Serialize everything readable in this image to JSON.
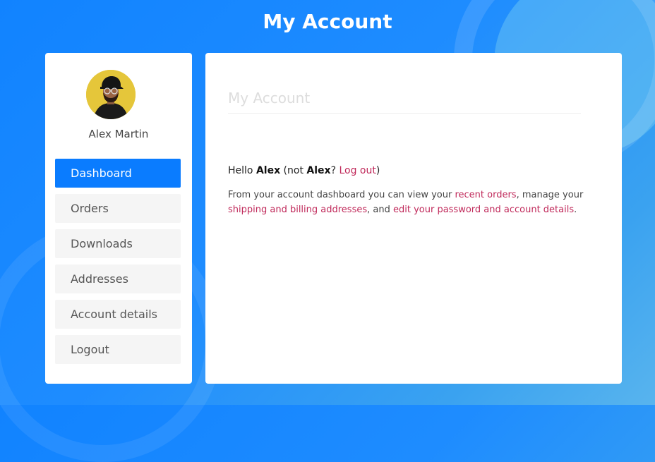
{
  "page": {
    "title": "My Account"
  },
  "user": {
    "name": "Alex Martin",
    "first_name": "Alex"
  },
  "sidebar": {
    "items": [
      {
        "label": "Dashboard",
        "active": true
      },
      {
        "label": "Orders"
      },
      {
        "label": "Downloads"
      },
      {
        "label": "Addresses"
      },
      {
        "label": "Account details"
      },
      {
        "label": "Logout"
      }
    ]
  },
  "content": {
    "heading": "My Account",
    "hello_prefix": "Hello ",
    "hello_not": " (not ",
    "hello_q": "? ",
    "logout_link": "Log out",
    "hello_close": ")",
    "intro_1": "From your account dashboard you can view your ",
    "recent_orders_link": "recent orders",
    "intro_2": ", manage your ",
    "addresses_link": "shipping and billing addresses",
    "intro_3": ", and ",
    "account_link": "edit your password and account details",
    "intro_4": "."
  },
  "colors": {
    "accent": "#0a7cff",
    "link": "#c0295a",
    "avatar_bg": "#e5c63a"
  },
  "icons": {
    "avatar": "user-avatar-photo"
  }
}
